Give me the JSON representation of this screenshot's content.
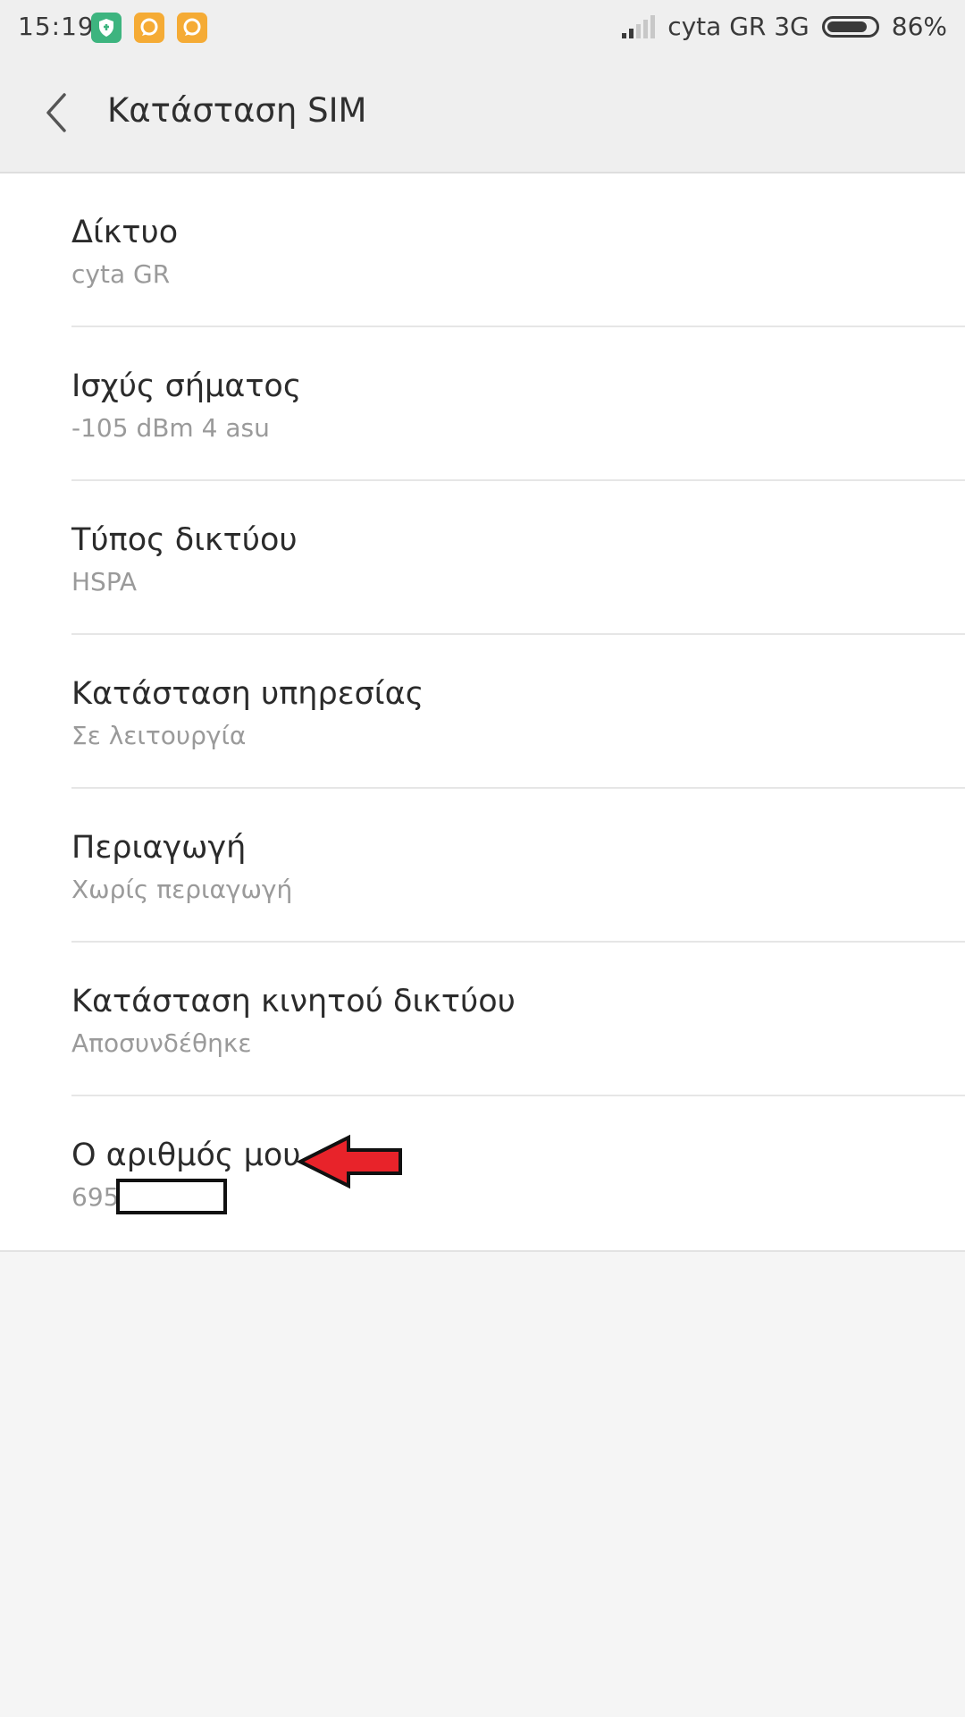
{
  "status_bar": {
    "time": "15:19",
    "carrier": "cyta GR 3G",
    "battery": "86%",
    "battery_level": 0.86,
    "notification_icons": [
      "shield-notification-icon",
      "message-notification-icon",
      "message-notification-icon"
    ]
  },
  "header": {
    "title": "Κατάσταση SIM",
    "back_icon": "back-arrow-icon"
  },
  "items": [
    {
      "title": "Δίκτυο",
      "value": "cyta GR"
    },
    {
      "title": "Ισχύς σήματος",
      "value": "-105 dBm 4 asu"
    },
    {
      "title": "Τύπος δικτύου",
      "value": "HSPA"
    },
    {
      "title": "Κατάσταση υπηρεσίας",
      "value": "Σε λειτουργία"
    },
    {
      "title": "Περιαγωγή",
      "value": "Χωρίς περιαγωγή"
    },
    {
      "title": "Κατάσταση κινητού δικτύου",
      "value": "Αποσυνδέθηκε"
    },
    {
      "title": "Ο αριθμός μου",
      "value": "695"
    }
  ],
  "colors": {
    "status_bg": "#efefef",
    "list_bg": "#ffffff",
    "page_bg": "#f5f5f5",
    "shield_green": "#3db47f",
    "notif_orange": "#f5ab35",
    "arrow_red": "#e8232a"
  }
}
